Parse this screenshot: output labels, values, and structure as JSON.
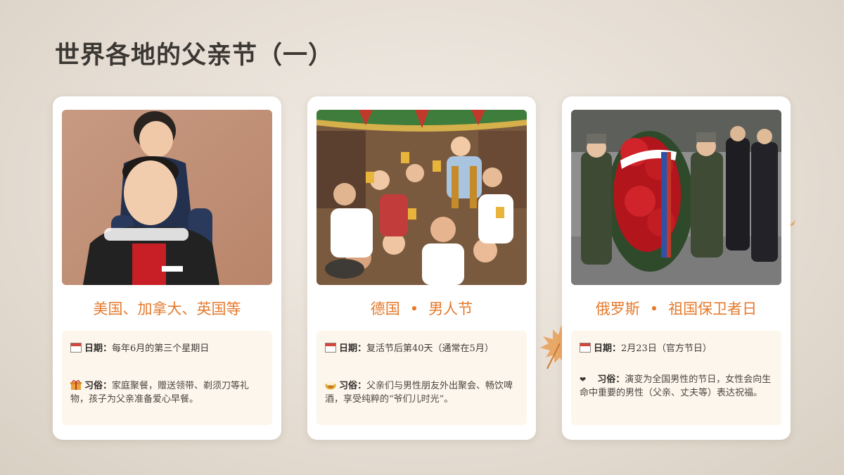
{
  "title": "世界各地的父亲节（一）",
  "separator": "•",
  "accent_color": "#e57a2c",
  "cards": [
    {
      "photo_icon": "father-son-photo",
      "heading": "美国、加拿大、英国等",
      "date_label": "日期：",
      "date_value": "每年6月的第三个星期日",
      "date_icon": "calendar-icon",
      "custom_label": "习俗：",
      "custom_value": "家庭聚餐，赠送领带、剃须刀等礼物，孩子为父亲准备爱心早餐。",
      "custom_icon": "gift-icon"
    },
    {
      "photo_icon": "beer-festival-photo",
      "heading_left": "德国",
      "heading_right": "男人节",
      "date_label": "日期：",
      "date_value": "复活节后第40天（通常在5月）",
      "date_icon": "calendar-icon",
      "custom_label": "习俗：",
      "custom_value": "父亲们与男性朋友外出聚会、畅饮啤酒，享受纯粹的“爷们儿时光”。",
      "custom_icon": "beer-icon"
    },
    {
      "photo_icon": "military-ceremony-photo",
      "heading_left": "俄罗斯",
      "heading_right": "祖国保卫者日",
      "date_label": "日期：",
      "date_value": "2月23日（官方节日）",
      "date_icon": "calendar-icon",
      "custom_label": "习俗：",
      "custom_value": "演变为全国男性的节日，女性会向生命中重要的男性（父亲、丈夫等）表达祝福。",
      "custom_icon": "heart-icon"
    }
  ]
}
